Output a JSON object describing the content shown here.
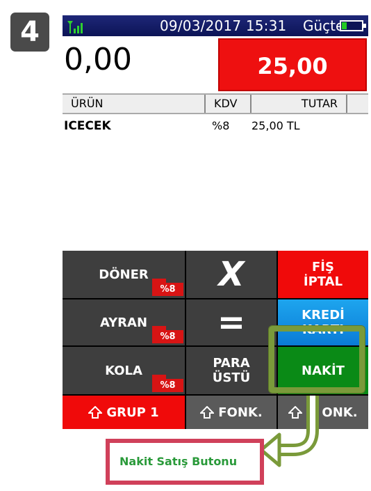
{
  "step": {
    "number": "4"
  },
  "statusbar": {
    "signal_icon": "signal-icon",
    "datetime": "09/03/2017 15:31",
    "power_label": "Güçte",
    "battery_icon": "battery-icon",
    "battery_level": 0.25
  },
  "amount": {
    "input_value": "0,00",
    "total_value": "25,00"
  },
  "table": {
    "headers": {
      "urun": "ÜRÜN",
      "kdv": "KDV",
      "tutar": "TUTAR"
    },
    "rows": [
      {
        "urun": "ICECEK",
        "kdv": "%8",
        "tutar": "25,00 TL"
      }
    ]
  },
  "keys": {
    "doner": {
      "label": "DÖNER",
      "vat": "%8"
    },
    "cancel_x": {
      "label": "X"
    },
    "fis_iptal": {
      "line1": "FİŞ",
      "line2": "İPTAL"
    },
    "ayran": {
      "label": "AYRAN",
      "vat": "%8"
    },
    "equals": {
      "label": "="
    },
    "kredi_karti": {
      "line1": "KREDİ",
      "line2": "KARTI"
    },
    "kola": {
      "label": "KOLA",
      "vat": "%8"
    },
    "para_ustu": {
      "line1": "PARA",
      "line2": "ÜSTÜ"
    },
    "nakit": {
      "label": "NAKİT"
    },
    "grup1": {
      "label": "GRUP 1"
    },
    "fonk1": {
      "label": "FONK."
    },
    "fonk2": {
      "label": "ONK."
    }
  },
  "annotation": {
    "callout_text": "Nakit Satış Butonu"
  },
  "colors": {
    "accent_red": "#f00a0a",
    "accent_green": "#0a8a16",
    "accent_blue": "#0a7bd6",
    "highlight": "#7a9a3a",
    "callout_border": "#d0405a",
    "callout_text": "#2a9a3a"
  }
}
